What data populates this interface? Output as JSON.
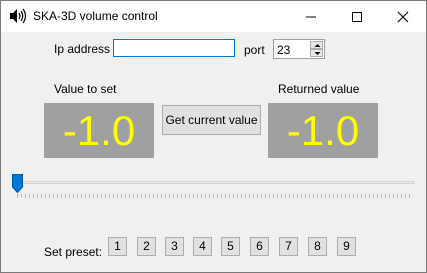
{
  "window": {
    "title": "SKA-3D volume control",
    "icon": "speaker-icon"
  },
  "connection": {
    "ip_label": "Ip address",
    "ip_value": "",
    "port_label": "port",
    "port_value": "23"
  },
  "values": {
    "set_label": "Value to set",
    "set_value": "-1.0",
    "returned_label": "Returned value",
    "returned_value": "-1.0",
    "get_button_label": "Get current value",
    "display_color": "#ffff00",
    "display_background": "#a0a0a0"
  },
  "slider": {
    "position": 0
  },
  "presets": {
    "label": "Set preset:",
    "buttons": [
      "1",
      "2",
      "3",
      "4",
      "5",
      "6",
      "7",
      "8",
      "9"
    ]
  }
}
